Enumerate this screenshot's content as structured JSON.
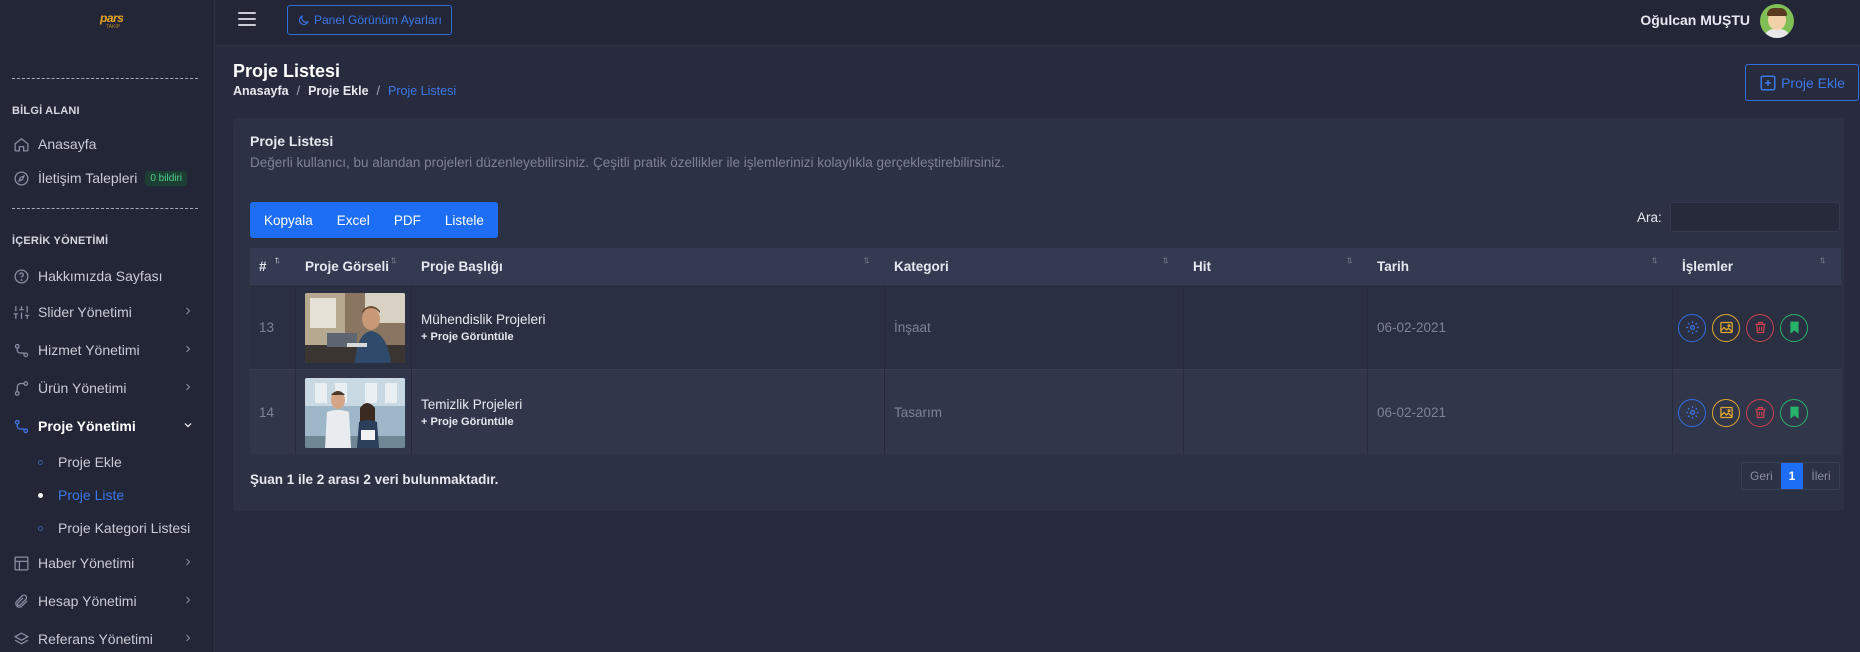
{
  "sidebar": {
    "logo_text": "pars",
    "logo_sub": "TAKIP",
    "section_info": "BİLGİ ALANI",
    "item_home": "Anasayfa",
    "item_contact": "İletişim Talepleri",
    "contact_badge": "0 bildiri",
    "section_content": "İÇERİK YÖNETİMİ",
    "item_about": "Hakkımızda Sayfası",
    "item_slider": "Slider Yönetimi",
    "item_service": "Hizmet Yönetimi",
    "item_product": "Ürün Yönetimi",
    "item_project": "Proje Yönetimi",
    "sub_add": "Proje Ekle",
    "sub_list": "Proje Liste",
    "sub_category": "Proje Kategori Listesi",
    "item_news": "Haber Yönetimi",
    "item_account": "Hesap Yönetimi",
    "item_reference": "Referans Yönetimi"
  },
  "topbar": {
    "theme_button": "Panel Görünüm Ayarları",
    "user_name": "Oğulcan MUŞTU"
  },
  "page": {
    "title": "Proje Listesi",
    "breadcrumb": [
      "Anasayfa",
      "Proje Ekle",
      "Proje Listesi"
    ],
    "add_button": "Proje Ekle"
  },
  "card": {
    "title": "Proje Listesi",
    "description": "Değerli kullanıcı, bu alandan projeleri düzenleyebilirsiniz. Çeşitli pratik özellikler ile işlemlerinizi kolaylıkla gerçekleştirebilirsiniz.",
    "export_buttons": [
      "Kopyala",
      "Excel",
      "PDF",
      "Listele"
    ],
    "search_label": "Ara:",
    "search_value": ""
  },
  "table": {
    "headers": [
      "#",
      "Proje Görseli",
      "Proje Başlığı",
      "Kategori",
      "Hit",
      "Tarih",
      "İşlemler"
    ],
    "rows": [
      {
        "id": "13",
        "title": "Mühendislik Projeleri",
        "link": "+ Proje Görüntüle",
        "category": "İnşaat",
        "hit": "",
        "date": "06-02-2021"
      },
      {
        "id": "14",
        "title": "Temizlik Projeleri",
        "link": "+ Proje Görüntüle",
        "category": "Tasarım",
        "hit": "",
        "date": "06-02-2021"
      }
    ]
  },
  "footer": {
    "info": "Şuan 1 ile 2 arası 2 veri bulunmaktadır.",
    "prev": "Geri",
    "page": "1",
    "next": "İleri"
  },
  "colors": {
    "accent": "#1e6ef5",
    "settings": "#2f6fe0",
    "image": "#e0a82e",
    "delete": "#c9424d",
    "bookmark": "#27b36a"
  }
}
